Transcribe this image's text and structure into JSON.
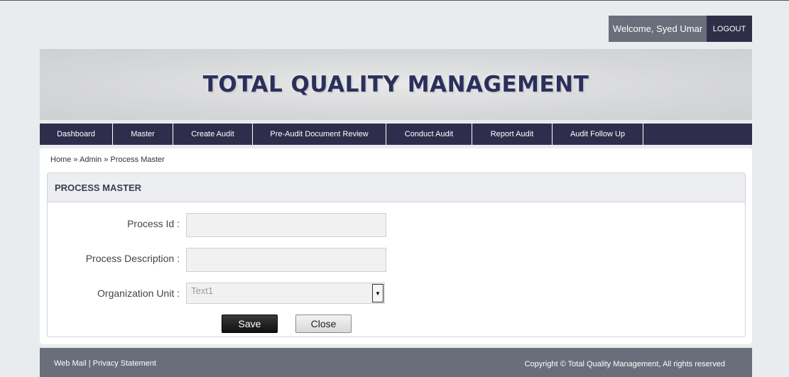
{
  "header": {
    "welcome_text": "Welcome, Syed Umar",
    "logout_label": "LOGOUT"
  },
  "banner": {
    "title": "TOTAL QUALITY MANAGEMENT"
  },
  "nav": {
    "items": [
      {
        "label": "Dashboard"
      },
      {
        "label": "Master"
      },
      {
        "label": "Create Audit"
      },
      {
        "label": "Pre-Audit Document Review"
      },
      {
        "label": "Conduct Audit"
      },
      {
        "label": "Report Audit"
      },
      {
        "label": "Audit Follow Up"
      }
    ]
  },
  "breadcrumb": {
    "home": "Home",
    "sep": "»",
    "admin": "Admin",
    "current": "Process Master"
  },
  "panel": {
    "title": "PROCESS MASTER"
  },
  "form": {
    "process_id_label": "Process Id :",
    "process_id_value": "",
    "process_description_label": "Process Description :",
    "process_description_value": "",
    "org_unit_label": "Organization Unit :",
    "org_unit_selected": "Text1",
    "save_label": "Save",
    "close_label": "Close"
  },
  "footer": {
    "web_mail": "Web Mail",
    "divider": "|",
    "privacy": "Privacy Statement",
    "copyright": "Copyright © Total Quality Management, All rights reserved"
  },
  "colors": {
    "nav_bg": "#2e2e4c",
    "title_color": "#2b2f5c",
    "footer_bg": "#6a6d7a"
  }
}
